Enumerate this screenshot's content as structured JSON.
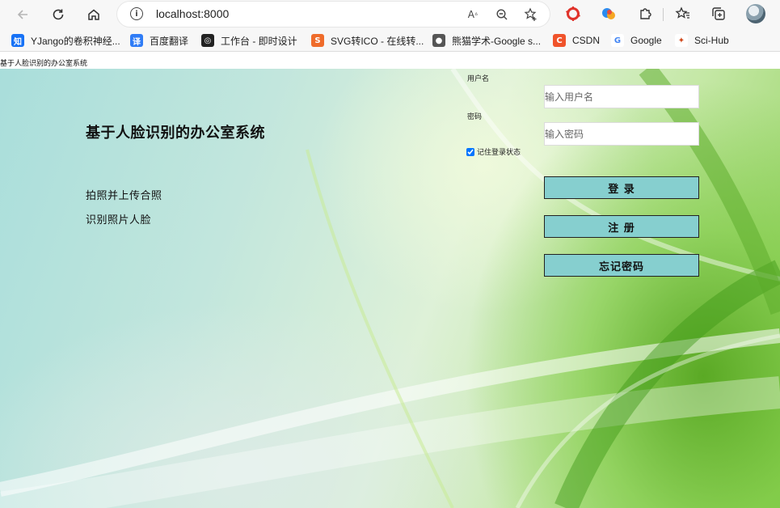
{
  "browser": {
    "url": "localhost:8000",
    "bookmarks": [
      {
        "label": "YJango的卷积神经...",
        "icon": "zhihu-icon",
        "icon_text": "知",
        "color": "#1772f6"
      },
      {
        "label": "百度翻译",
        "icon": "baidu-translate-icon",
        "icon_text": "译",
        "color": "#2f7cf6"
      },
      {
        "label": "工作台 - 即时设计",
        "icon": "jishi-design-icon",
        "icon_text": "◎",
        "color": "#222222"
      },
      {
        "label": "SVG转ICO - 在线转...",
        "icon": "svg-convert-icon",
        "icon_text": "S",
        "color": "#ef6c2b"
      },
      {
        "label": "熊猫学术-Google s...",
        "icon": "panda-icon",
        "icon_text": "●",
        "color": "#555555"
      },
      {
        "label": "CSDN",
        "icon": "csdn-icon",
        "icon_text": "C",
        "color": "#f0532b"
      },
      {
        "label": "Google",
        "icon": "google-icon",
        "icon_text": "G",
        "color": "#4285f4"
      },
      {
        "label": "Sci-Hub",
        "icon": "scihub-icon",
        "icon_text": "✦",
        "color": "#d14b1e"
      }
    ]
  },
  "page": {
    "caption": "基于人脸识别的办公室系统",
    "title": "基于人脸识别的办公室系统",
    "menu": [
      "拍照并上传合照",
      "识别照片人脸"
    ],
    "login": {
      "username_label": "用户名",
      "username_placeholder": "输入用户名",
      "password_label": "密码",
      "password_placeholder": "输入密码",
      "remember_label": "记住登录状态",
      "remember_checked": true,
      "login_button": "登 录",
      "register_button": "注 册",
      "forgot_button": "忘记密码"
    }
  }
}
